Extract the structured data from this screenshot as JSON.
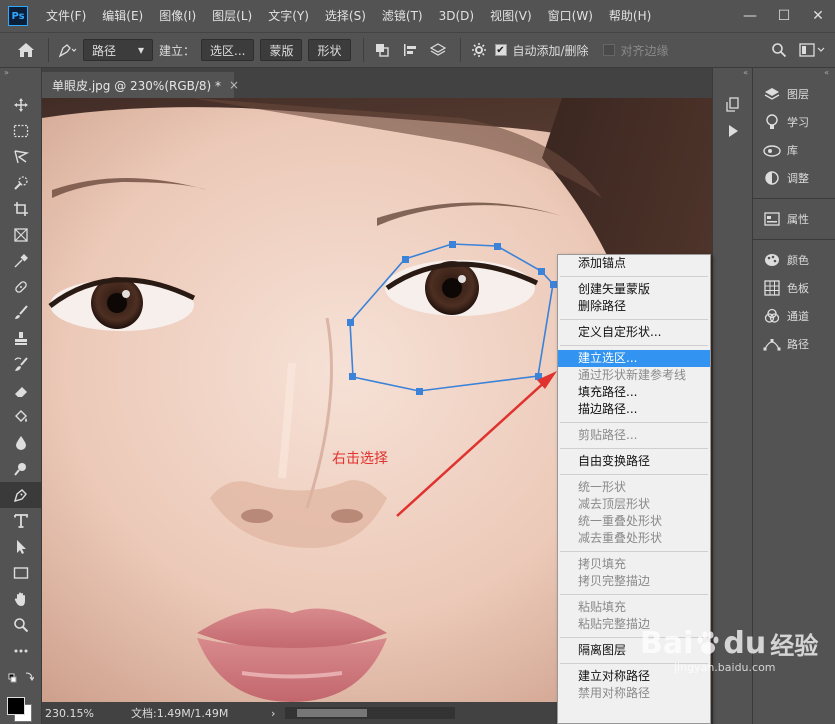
{
  "app": {
    "logo": "Ps",
    "menu": [
      "文件(F)",
      "编辑(E)",
      "图像(I)",
      "图层(L)",
      "文字(Y)",
      "选择(S)",
      "滤镜(T)",
      "3D(D)",
      "视图(V)",
      "窗口(W)",
      "帮助(H)"
    ],
    "window_buttons": [
      "—",
      "☐",
      "✕"
    ]
  },
  "options": {
    "mode_value": "路径",
    "make_label": "建立：",
    "selection_btn": "选区...",
    "mask_btn": "蒙版",
    "shape_btn": "形状",
    "auto_add_label": "自动添加/删除",
    "auto_add_checked": true,
    "align_edges_label": "对齐边缘",
    "align_edges_checked": false
  },
  "document": {
    "tab_title": "单眼皮.jpg @ 230%(RGB/8) *",
    "close": "×",
    "annotation": "右击选择",
    "annotation_color": "#e0322e"
  },
  "status": {
    "zoom": "230.15%",
    "doc_info": "文档:1.49M/1.49M",
    "arrow": "›"
  },
  "panels": {
    "group1": [
      "图层",
      "学习",
      "库",
      "调整"
    ],
    "group2": [
      "属性"
    ],
    "group3": [
      "颜色",
      "色板",
      "通道",
      "路径"
    ]
  },
  "context_menu": {
    "highlighted": "建立选区...",
    "groups": [
      [
        {
          "label": "添加锚点",
          "enabled": true
        }
      ],
      [
        {
          "label": "创建矢量蒙版",
          "enabled": true
        },
        {
          "label": "删除路径",
          "enabled": true
        }
      ],
      [
        {
          "label": "定义自定形状...",
          "enabled": true
        }
      ],
      [
        {
          "label": "建立选区...",
          "enabled": true
        },
        {
          "label": "通过形状新建参考线",
          "enabled": false
        },
        {
          "label": "填充路径...",
          "enabled": true
        },
        {
          "label": "描边路径...",
          "enabled": true
        }
      ],
      [
        {
          "label": "剪贴路径...",
          "enabled": false
        }
      ],
      [
        {
          "label": "自由变换路径",
          "enabled": true
        }
      ],
      [
        {
          "label": "统一形状",
          "enabled": false
        },
        {
          "label": "减去顶层形状",
          "enabled": false
        },
        {
          "label": "统一重叠处形状",
          "enabled": false
        },
        {
          "label": "减去重叠处形状",
          "enabled": false
        }
      ],
      [
        {
          "label": "拷贝填充",
          "enabled": false
        },
        {
          "label": "拷贝完整描边",
          "enabled": false
        }
      ],
      [
        {
          "label": "粘贴填充",
          "enabled": false
        },
        {
          "label": "粘贴完整描边",
          "enabled": false
        }
      ],
      [
        {
          "label": "隔离图层",
          "enabled": true
        }
      ],
      [
        {
          "label": "建立对称路径",
          "enabled": true
        },
        {
          "label": "禁用对称路径",
          "enabled": false
        }
      ]
    ]
  },
  "watermark": {
    "brand": "Bai",
    "paw": "du",
    "cn": "经验",
    "url": "jingyan.baidu.com"
  },
  "colors": {
    "path_stroke": "#3b82d8",
    "highlight": "#3294f0",
    "ui_bg": "#535353"
  }
}
